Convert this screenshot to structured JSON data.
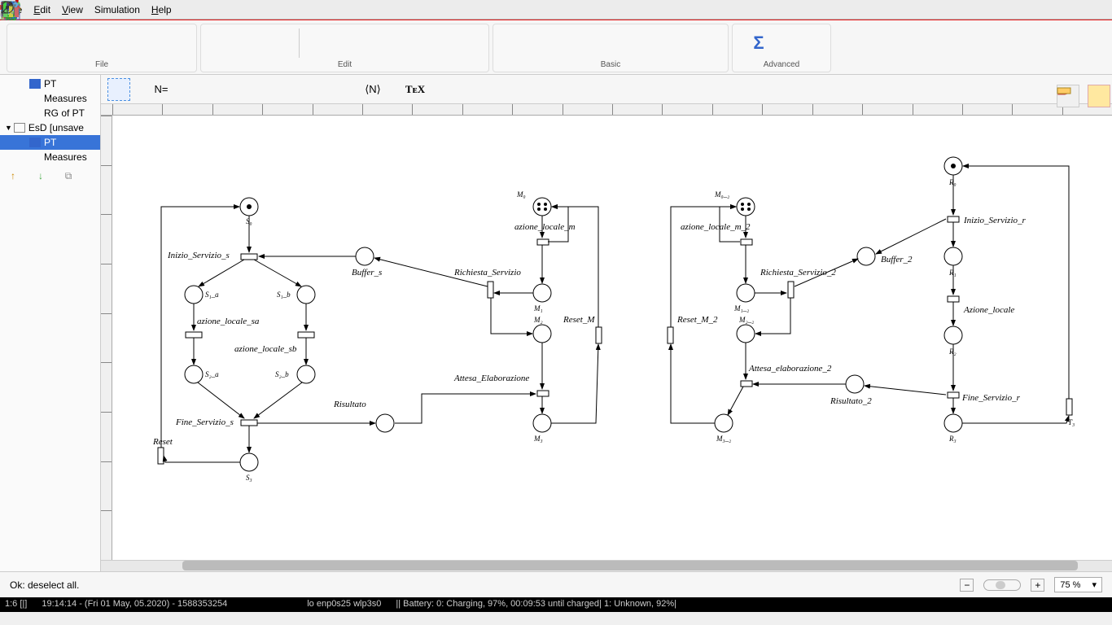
{
  "menu": {
    "file": "File",
    "edit": "Edit",
    "view": "View",
    "simulation": "Simulation",
    "help": "Help"
  },
  "toolbar_groups": {
    "file": "File",
    "edit": "Edit",
    "basic": "Basic",
    "advanced": "Advanced"
  },
  "tree": {
    "pt": "PT",
    "measures": "Measures",
    "rg": "RG of PT",
    "esd": "EsD [unsave",
    "pt2": "PT",
    "measures2": "Measures"
  },
  "tooltab": {
    "neq": "N=",
    "angle": "⟨N⟩",
    "tex": "TᴇX"
  },
  "status": "Ok: deselect all.",
  "zoom": "75 %",
  "osbar": {
    "seg1": "1:6 [|]",
    "seg2": "19:14:14 - (Fri 01 May, 05.2020) - 1588353254",
    "seg3": "lo enp0s25 wlp3s0",
    "seg4": "||  Battery: 0: Charging, 97%, 00:09:53 until charged| 1: Unknown, 92%|"
  },
  "net": {
    "places": {
      "S0": "S₀",
      "S1a": "S₁_a",
      "S1b": "S₁_b",
      "S2a": "S₂_a",
      "S2b": "S₂_b",
      "S3": "S₃",
      "Buffer_s": "Buffer_s",
      "Risultato": "Risultato",
      "M0": "M₀",
      "M1": "M₁",
      "M2": "M₂",
      "M3": "M₃",
      "M0_2": "M₀_₂",
      "M1_2": "M₁_₂",
      "M2_2": "M₂_₂",
      "M3_2": "M₃_₂",
      "Buffer_2": "Buffer_2",
      "Risultato_2": "Risultato_2",
      "R0": "R₀",
      "R1": "R₁",
      "R2": "R₂",
      "R3": "R₃"
    },
    "transitions": {
      "Inizio_Servizio_s": "Inizio_Servizio_s",
      "azione_locale_sa": "azione_locale_sa",
      "azione_locale_sb": "azione_locale_sb",
      "Fine_Servizio_s": "Fine_Servizio_s",
      "Reset": "Reset",
      "azione_locale_m": "azione_locale_m",
      "Richiesta_Servizio": "Richiesta_Servizio",
      "Reset_M": "Reset_M",
      "Attesa_Elaborazione": "Attesa_Elaborazione",
      "azione_locale_m_2": "azione_locale_m_2",
      "Richiesta_Servizio_2": "Richiesta_Servizio_2",
      "Reset_M_2": "Reset_M_2",
      "Attesa_elaborazione_2": "Attesa_elaborazione_2",
      "Inizio_Servizio_r": "Inizio_Servizio_r",
      "Azione_locale": "Azione_locale",
      "Fine_Servizio_r": "Fine_Servizio_r",
      "T3": "T₃"
    }
  }
}
